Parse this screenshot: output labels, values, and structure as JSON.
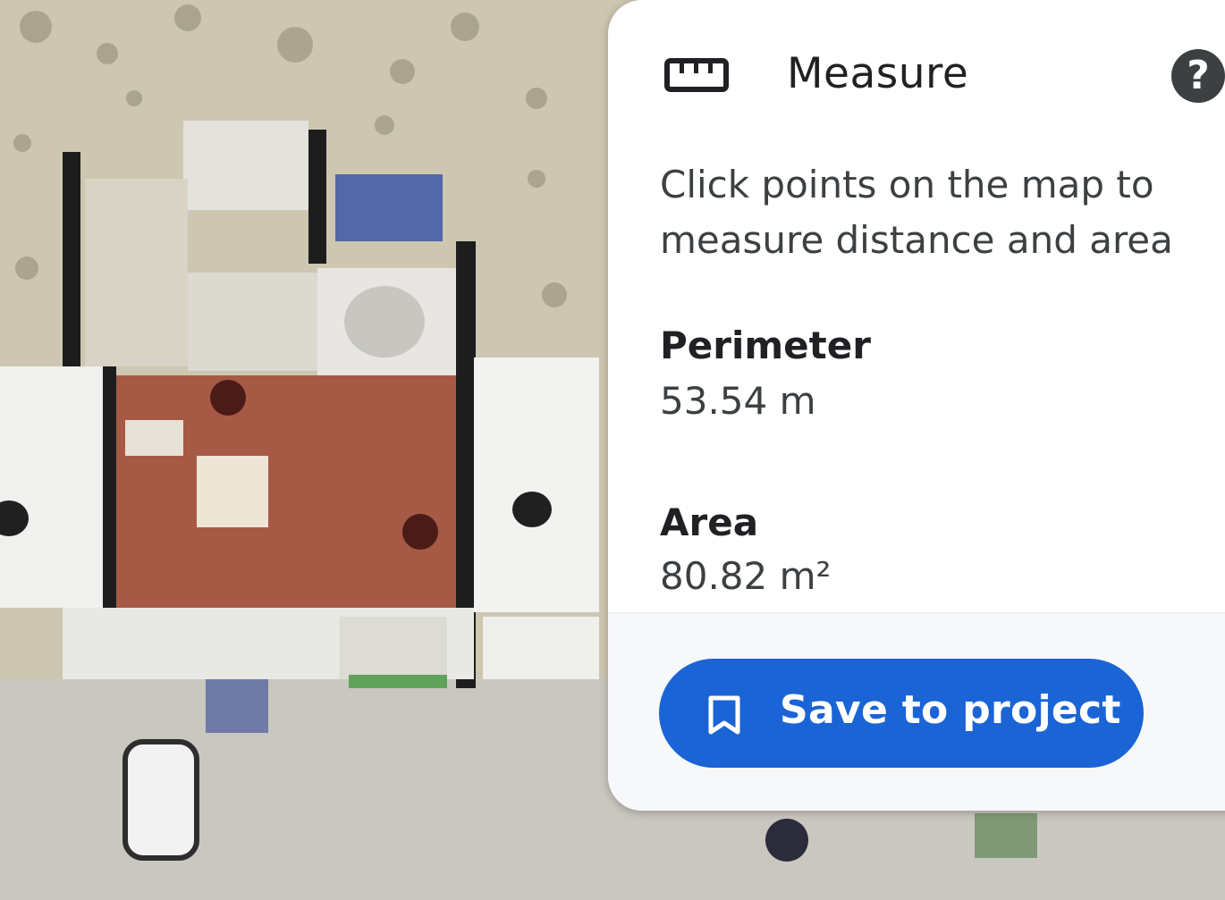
{
  "measure_panel": {
    "title": "Measure",
    "instruction": "Click points on the map to measure distance and area",
    "perimeter": {
      "label": "Perimeter",
      "value": "53.54 m"
    },
    "area": {
      "label": "Area",
      "value": "80.82 m²"
    },
    "save_button_label": "Save to project",
    "icons": {
      "ruler": "ruler-icon",
      "help": "help-icon",
      "bookmark": "bookmark-icon"
    },
    "colors": {
      "accent": "#1a64d6",
      "help_bg": "#3c4043",
      "footer_bg": "#f7f8fa"
    }
  }
}
